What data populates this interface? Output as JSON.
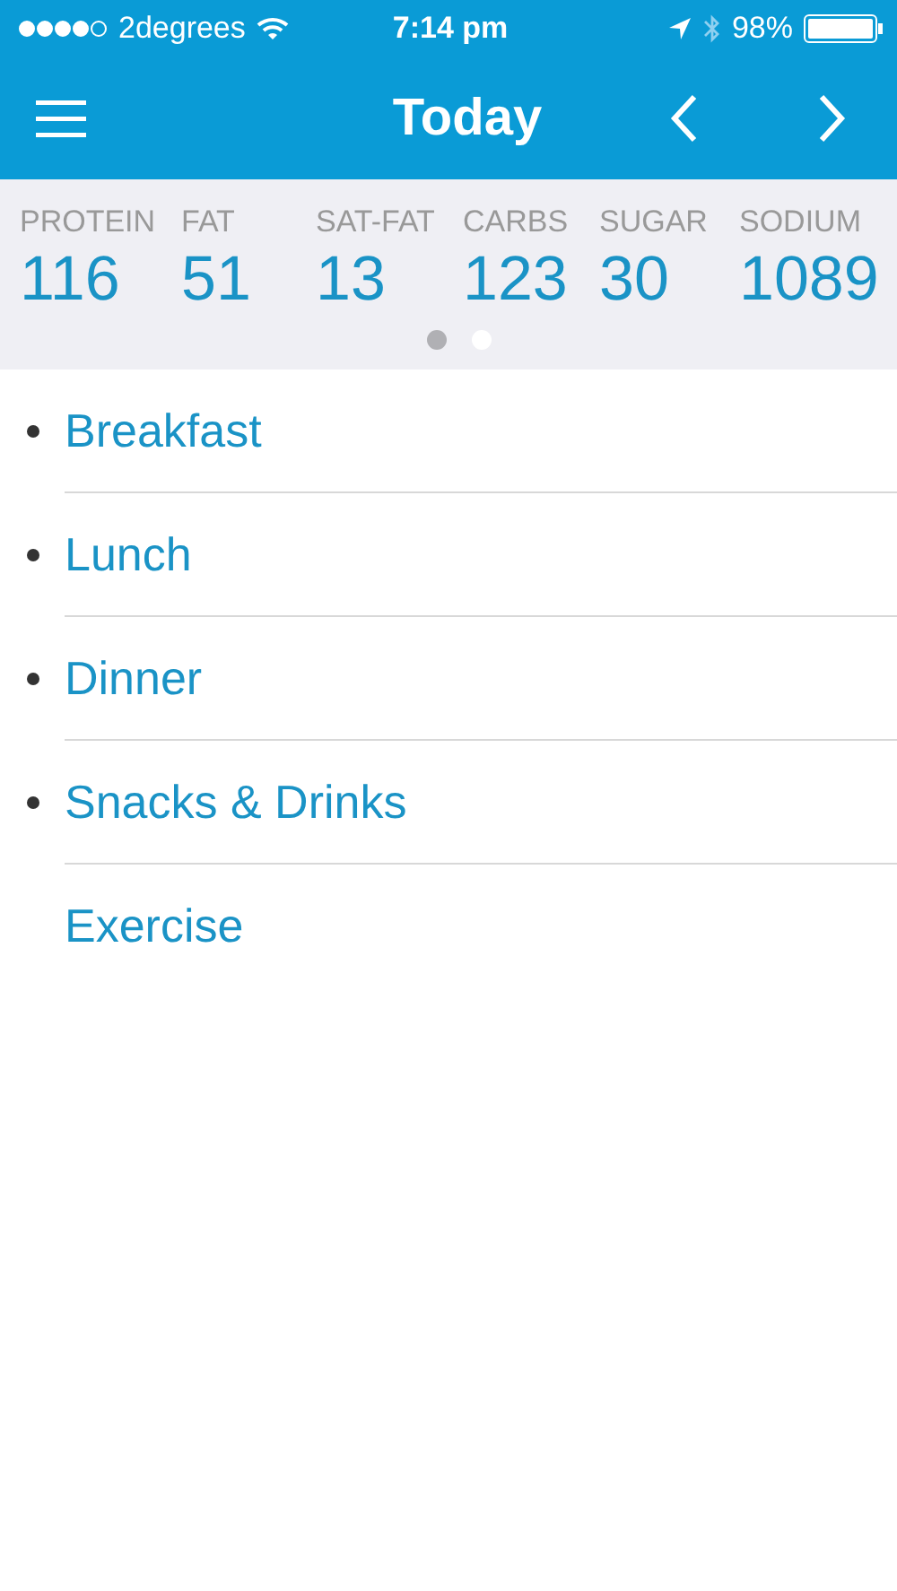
{
  "status_bar": {
    "carrier": "2degrees",
    "time": "7:14 pm",
    "battery": "98%"
  },
  "nav": {
    "title": "Today"
  },
  "nutrients": [
    {
      "label": "PROTEIN",
      "value": "116"
    },
    {
      "label": "FAT",
      "value": "51"
    },
    {
      "label": "SAT-FAT",
      "value": "13"
    },
    {
      "label": "CARBS",
      "value": "123"
    },
    {
      "label": "SUGAR",
      "value": "30"
    },
    {
      "label": "SODIUM",
      "value": "1089"
    }
  ],
  "pages": [
    {
      "selected": true
    },
    {
      "selected": false
    }
  ],
  "meals": [
    {
      "label": "Breakfast",
      "bulleted": true
    },
    {
      "label": "Lunch",
      "bulleted": true
    },
    {
      "label": "Dinner",
      "bulleted": true
    },
    {
      "label": "Snacks & Drinks",
      "bulleted": true
    },
    {
      "label": "Exercise",
      "bulleted": false
    }
  ]
}
